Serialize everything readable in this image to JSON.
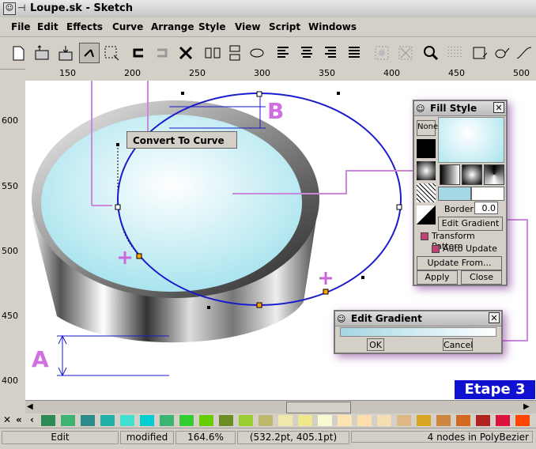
{
  "window": {
    "title": "Loupe.sk - Sketch"
  },
  "menu": [
    "File",
    "Edit",
    "Effects",
    "Curve",
    "Arrange",
    "Style",
    "View",
    "Script",
    "Windows"
  ],
  "ruler": {
    "h_labels": [
      "150",
      "200",
      "250",
      "300",
      "350",
      "400",
      "450",
      "500"
    ],
    "v_labels": [
      "600",
      "550",
      "500",
      "450",
      "400"
    ]
  },
  "context_menu": {
    "label": "Convert To Curve"
  },
  "annotations": {
    "a": "A",
    "b": "B",
    "etape": "Etape 3"
  },
  "fill_style": {
    "title": "Fill Style",
    "none_label": "None",
    "border_label": "Border",
    "border_value": "0.0",
    "edit_gradient": "Edit Gradient",
    "transform_pattern": "Transform Pattern",
    "auto_update": "Auto Update",
    "update_from": "Update From...",
    "apply": "Apply",
    "close": "Close"
  },
  "edit_gradient": {
    "title": "Edit Gradient",
    "ok": "OK",
    "cancel": "Cancel"
  },
  "palette": {
    "colors": [
      "#2e8b57",
      "#3cb371",
      "#2e8b8b",
      "#20b2aa",
      "#40e0d0",
      "#00ced1",
      "#3cb371",
      "#32cd32",
      "#66cd00",
      "#6b8e23",
      "#9acd32",
      "#bdb76b",
      "#eee8aa",
      "#f0e68c",
      "#fafad2",
      "#ffe4b5",
      "#ffdead",
      "#f5deb3",
      "#deb887",
      "#daa520",
      "#cd853f",
      "#d2691e",
      "#b22222",
      "#dc143c",
      "#ff4500"
    ]
  },
  "status": {
    "mode": "Edit",
    "modified": "modified",
    "zoom": "164.6%",
    "coords": "(532.2pt, 405.1pt)",
    "selection": "4 nodes in PolyBezier"
  }
}
